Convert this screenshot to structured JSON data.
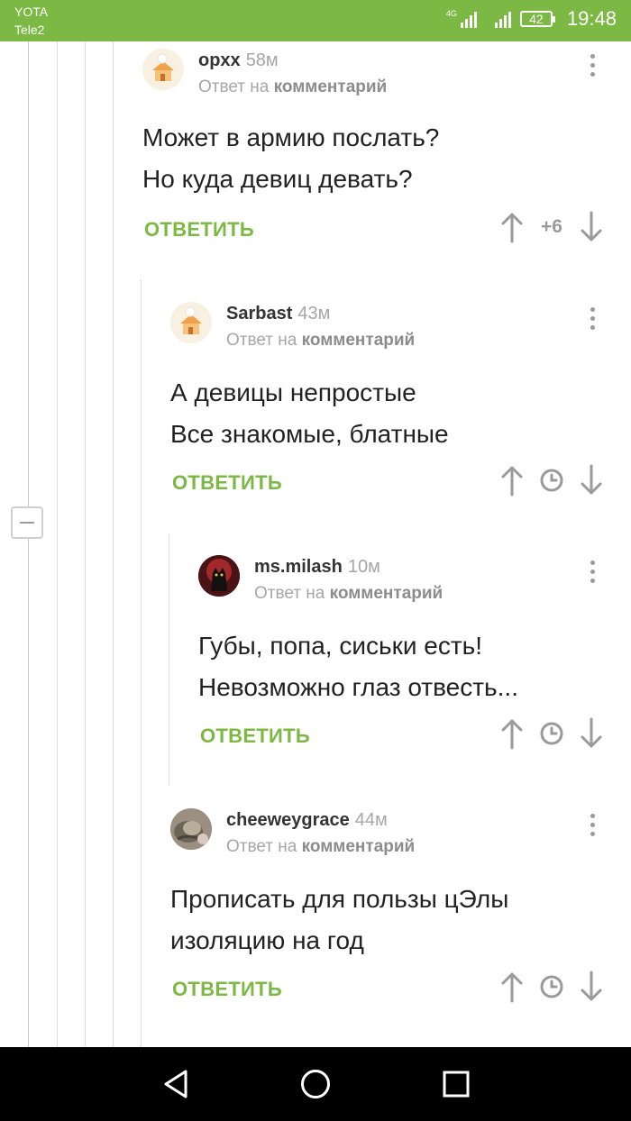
{
  "status_bar": {
    "carrier_1": "YOTA",
    "carrier_2": "Tele2",
    "network": "4G",
    "battery": "42",
    "time": "19:48"
  },
  "colors": {
    "accent": "#7cb944",
    "muted": "#a6a6a6",
    "text": "#222222"
  },
  "comments": [
    {
      "author": "opxx",
      "time": "58м",
      "reply_prefix": "Ответ на",
      "reply_target": "комментарий",
      "lines": [
        "Может в армию послать?",
        "Но куда девиц девать?"
      ],
      "reply_label": "ОТВЕТИТЬ",
      "rating": "+6",
      "avatar": "cottage-avatar"
    },
    {
      "author": "Sarbast",
      "time": "43м",
      "reply_prefix": "Ответ на",
      "reply_target": "комментарий",
      "lines": [
        "А девицы непростые",
        "Все знакомые, блатные"
      ],
      "reply_label": "ОТВЕТИТЬ",
      "rating_hidden": true,
      "avatar": "cottage-avatar"
    },
    {
      "author": "ms.milash",
      "time": "10м",
      "reply_prefix": "Ответ на",
      "reply_target": "комментарий",
      "lines": [
        "Губы, попа, сиськи есть!",
        "Невозможно глаз отвесть..."
      ],
      "reply_label": "ОТВЕТИТЬ",
      "rating_hidden": true,
      "avatar": "dark-cat-avatar"
    },
    {
      "author": "cheeweygrace",
      "time": "44м",
      "reply_prefix": "Ответ на",
      "reply_target": "комментарий",
      "lines": [
        "Прописать для пользы цЭлы",
        "изоляцию на год"
      ],
      "reply_label": "ОТВЕТИТЬ",
      "rating_hidden": true,
      "avatar": "cat-photo-avatar"
    }
  ],
  "nav_bar": {
    "icons": [
      "back-icon",
      "home-icon",
      "recents-icon"
    ]
  }
}
